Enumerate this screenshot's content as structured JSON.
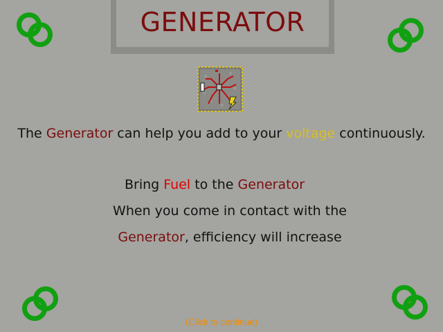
{
  "title": "GENERATOR",
  "intro": {
    "pre": "The ",
    "generator": "Generator",
    "mid": " can help you add to your ",
    "voltage": "voltage",
    "post": " continuously."
  },
  "fuel_line": {
    "pre": "Bring ",
    "fuel": "Fuel",
    "mid": " to the ",
    "generator": "Generator"
  },
  "contact_line": "When you come in contact with the",
  "efficiency_line": {
    "generator": "Generator",
    "post": ", efficiency will increase"
  },
  "continue": "(Click to continue)",
  "colors": {
    "background": "#a4a4a0",
    "title": "#7a0d0d",
    "ring": "#11a011",
    "fuel": "#e00000",
    "voltage": "#d8c020",
    "continue": "#f08c00"
  },
  "icons": [
    "green-rings-icon",
    "generator-tile-icon"
  ]
}
